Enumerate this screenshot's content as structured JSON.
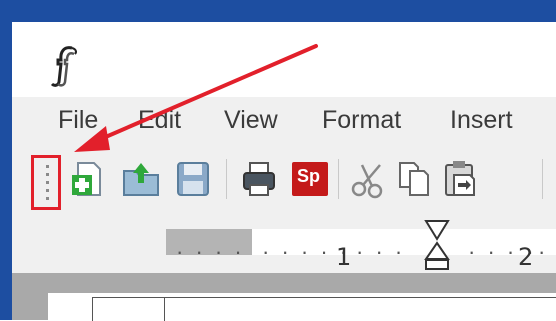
{
  "app": {
    "icon": "app-logo-icon"
  },
  "menu": {
    "items": [
      {
        "label": "File"
      },
      {
        "label": "Edit"
      },
      {
        "label": "View"
      },
      {
        "label": "Format"
      },
      {
        "label": "Insert"
      }
    ]
  },
  "toolbar": {
    "grip": "toolbar-grip-handle",
    "icons": [
      "new-document-icon",
      "open-folder-icon",
      "save-icon",
      "print-icon",
      "spell-check-icon",
      "cut-icon",
      "copy-icon",
      "paste-icon"
    ],
    "spell_label": "Sp"
  },
  "ruler": {
    "mark1": "1",
    "mark2": "2"
  },
  "annotation": {
    "color": "#e2202b"
  }
}
